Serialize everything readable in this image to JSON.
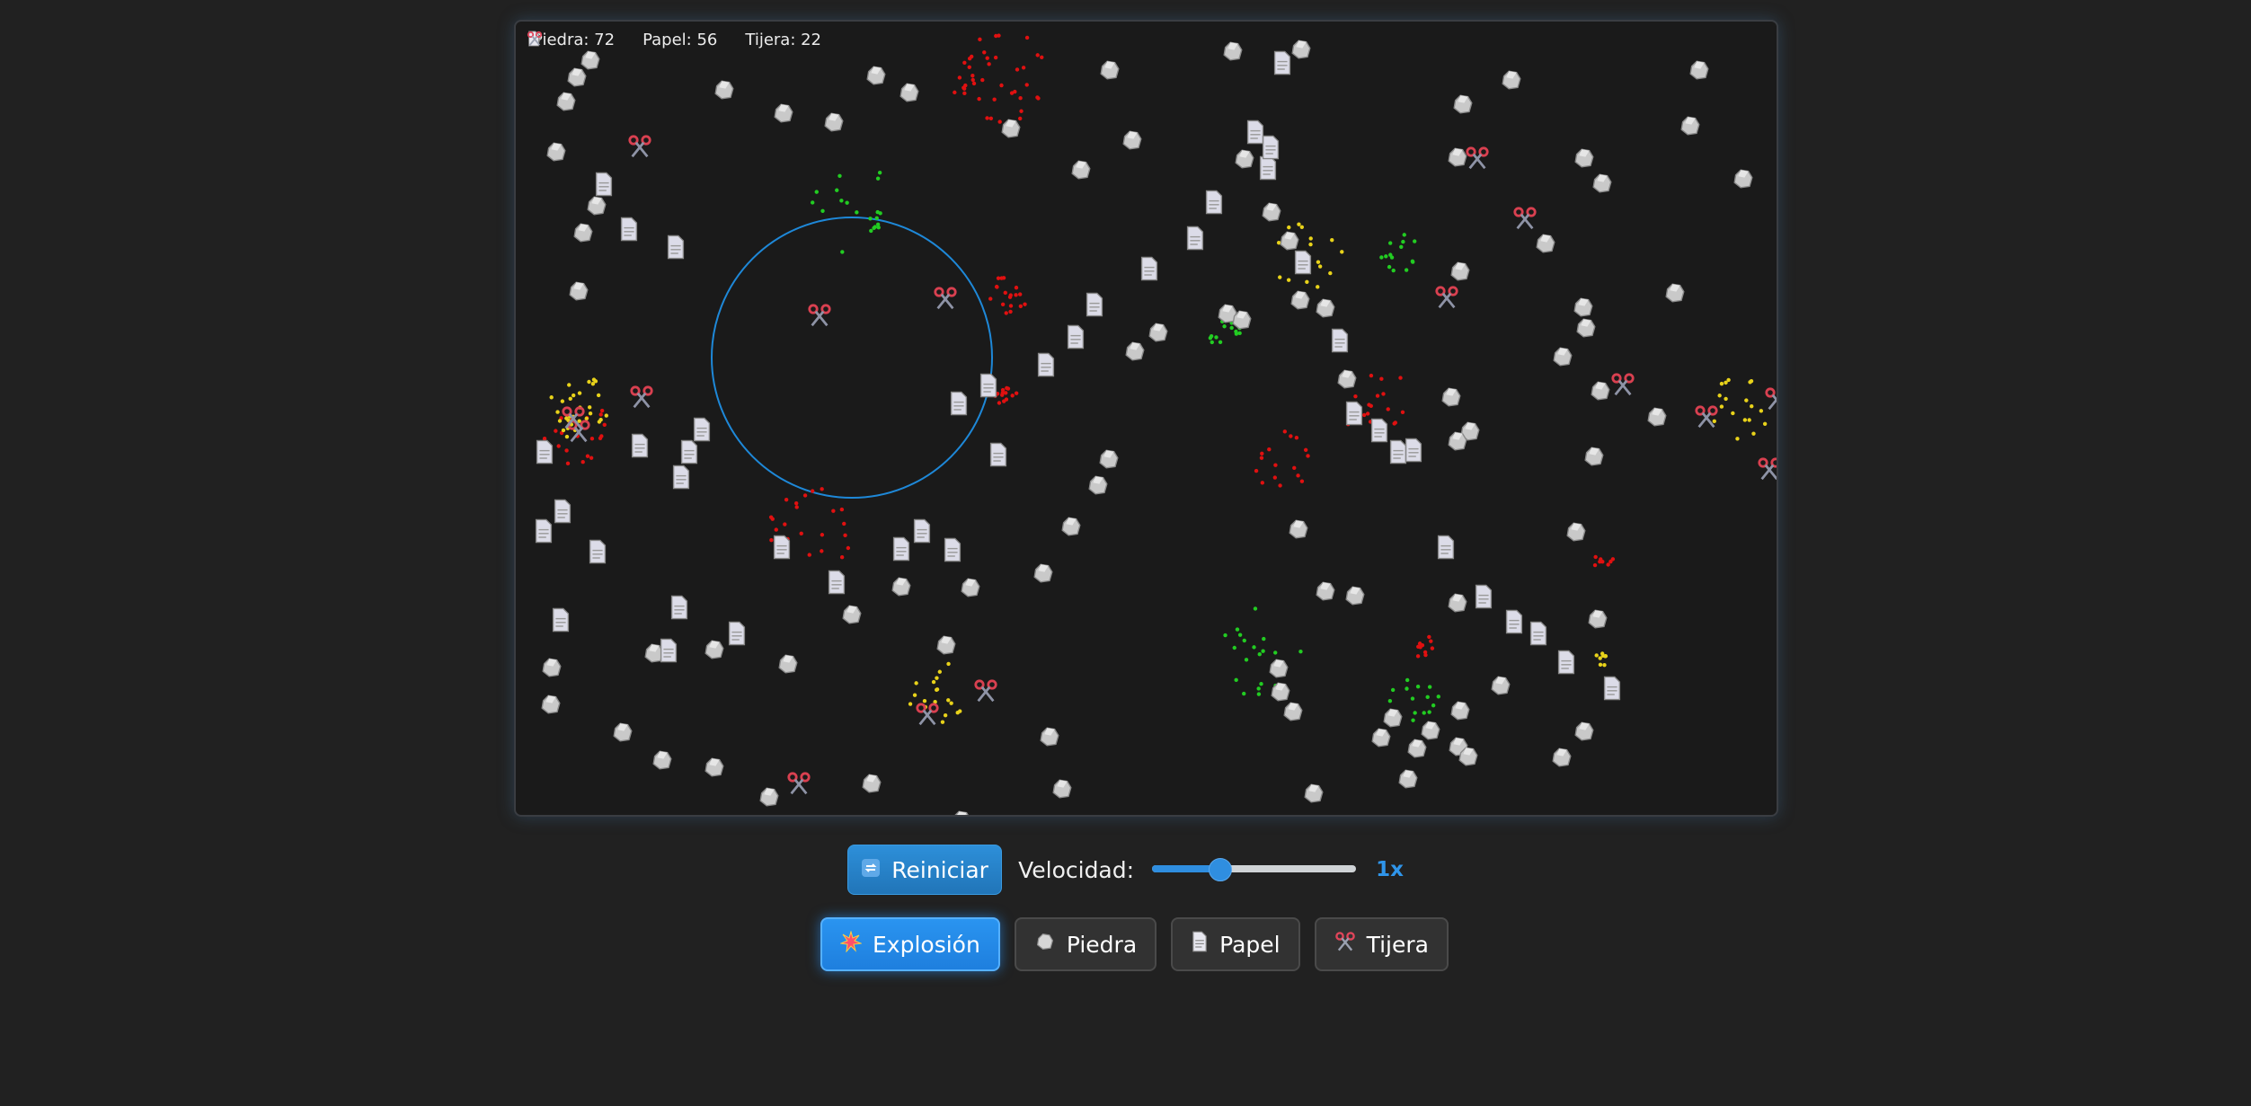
{
  "hud": {
    "rock": {
      "icon": "rock-icon",
      "label": "Piedra: 72"
    },
    "paper": {
      "icon": "paper-icon",
      "label": "Papel: 56"
    },
    "scissors": {
      "icon": "scissors-icon",
      "label": "Tijera: 22"
    }
  },
  "controls": {
    "restart_label": "Reiniciar",
    "restart_icon": "restart-icon",
    "speed_label": "Velocidad:",
    "speed_value": "1x",
    "speed_fraction": 0.33
  },
  "modes": [
    {
      "id": "explosion",
      "label": "Explosión",
      "icon": "explosion-icon",
      "active": true
    },
    {
      "id": "rock",
      "label": "Piedra",
      "icon": "rock-icon",
      "active": false
    },
    {
      "id": "paper",
      "label": "Papel",
      "icon": "paper-icon",
      "active": false
    },
    {
      "id": "scissors",
      "label": "Tijera",
      "icon": "scissors-icon",
      "active": false
    }
  ],
  "colors": {
    "accent": "#2f8ee0",
    "explosion_ring": "#1e88d8",
    "particle_red": "#e01010",
    "particle_green": "#22cc22",
    "particle_yellow": "#e8d21a",
    "rock": "#c8c8c8",
    "paper": "#d9d9e8",
    "scissors": "#d94050"
  }
}
